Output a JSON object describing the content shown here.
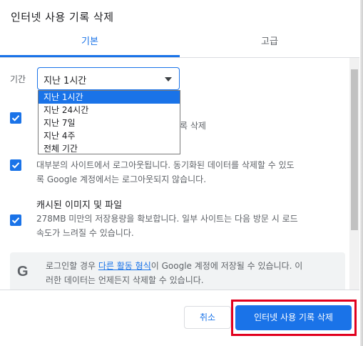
{
  "dialog": {
    "title": "인터넷 사용 기록 삭제"
  },
  "tabs": [
    {
      "label": "기본",
      "active": true
    },
    {
      "label": "고급",
      "active": false
    }
  ],
  "time_range": {
    "label": "기간",
    "selected": "지난 1시간",
    "options": [
      "지난 1시간",
      "지난 24시간",
      "지난 7일",
      "지난 4주",
      "전체 기간"
    ]
  },
  "items": [
    {
      "checked": true,
      "description": "록 삭제"
    },
    {
      "checked": true,
      "description_line1": "대부분의 사이트에서 로그아웃됩니다. 동기화된 데이터를 삭제할 수 있도",
      "description_line2": "록 Google 계정에서는 로그아웃되지 않습니다."
    },
    {
      "checked": true,
      "title": "캐시된 이미지 및 파일",
      "description_line1": "278MB 미만의 저장용량을 확보합니다. 일부 사이트는 다음 방문 시 로드",
      "description_line2": "속도가 느려질 수 있습니다."
    }
  ],
  "info": {
    "icon": "google-g-icon",
    "text_before": "로그인할 경우 ",
    "link": "다른 활동 형식",
    "text_after": "이 Google 계정에 저장될 수 있습니다. 이",
    "line2": "러한 데이터는 언제든지 삭제할 수 있습니다."
  },
  "footer": {
    "cancel_label": "취소",
    "delete_label": "인터넷 사용 기록 삭제"
  },
  "colors": {
    "accent": "#1a73e8",
    "highlight_outline": "#e1001e"
  }
}
